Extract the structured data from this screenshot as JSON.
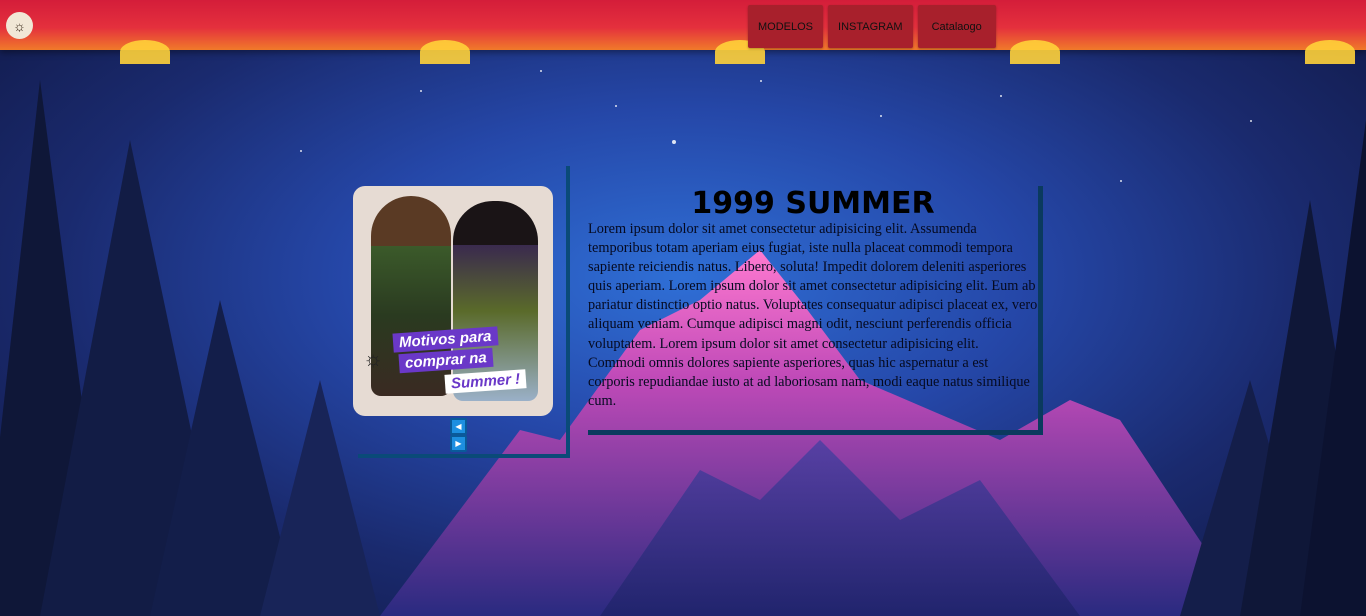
{
  "header": {
    "logo_icon": "sun-icon",
    "nav": [
      {
        "label": "MODELOS"
      },
      {
        "label": "INSTAGRAM"
      },
      {
        "label": "Catalaogo"
      }
    ],
    "colors": {
      "bar": "#e4303d",
      "button": "#a8202c"
    }
  },
  "carousel": {
    "badge_lines": [
      "Motivos para",
      "comprar na",
      "Summer !"
    ],
    "prev_icon": "triangle-left-icon",
    "next_icon": "triangle-right-icon"
  },
  "article": {
    "title": "1999 SUMMER",
    "body": "Lorem ipsum dolor sit amet consectetur adipisicing elit. Assumenda temporibus totam aperiam eius fugiat, iste nulla placeat commodi tempora sapiente reiciendis natus. Libero, soluta! Impedit dolorem deleniti asperiores quis aperiam. Lorem ipsum dolor sit amet consectetur adipisicing elit. Eum ab pariatur distinctio optio natus. Voluptates consequatur adipisci placeat ex, vero aliquam veniam. Cumque adipisci magni odit, nesciunt perferendis officia voluptatem. Lorem ipsum dolor sit amet consectetur adipisicing elit. Commodi omnis dolores sapiente asperiores, quas hic aspernatur a est corporis repudiandae iusto at ad laboriosam nam, modi eaque natus similique cum."
  }
}
